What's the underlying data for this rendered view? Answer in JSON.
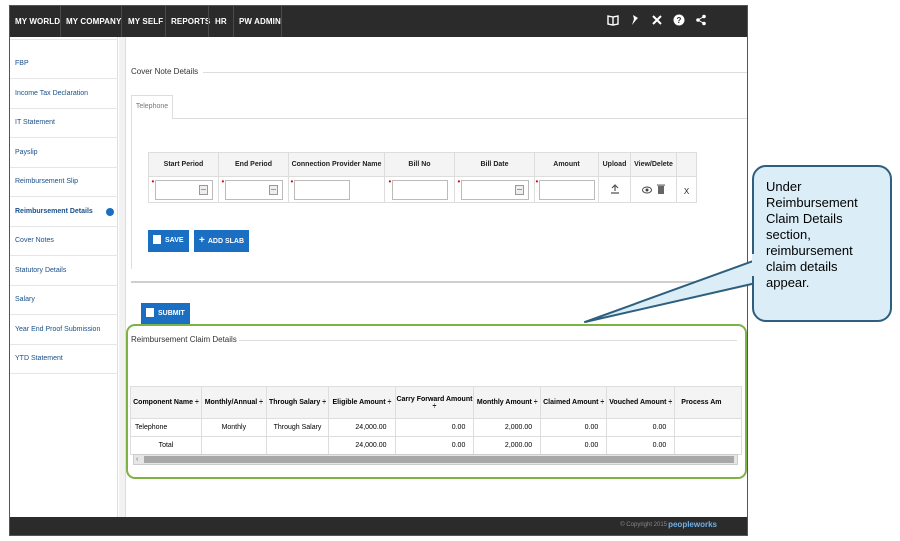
{
  "topnav": {
    "items": [
      "MY WORLD",
      "MY COMPANY",
      "MY SELF",
      "REPORTS",
      "HR",
      "PW ADMIN"
    ],
    "icons": [
      "book-icon",
      "pin-icon",
      "tools-icon",
      "help-icon",
      "share-icon"
    ]
  },
  "sidebar": {
    "items": [
      {
        "label": "FBP"
      },
      {
        "label": "Income Tax Declaration"
      },
      {
        "label": "IT Statement"
      },
      {
        "label": "Payslip"
      },
      {
        "label": "Reimbursement Slip"
      },
      {
        "label": "Reimbursement Details",
        "active": true
      },
      {
        "label": "Cover Notes"
      },
      {
        "label": "Statutory Details"
      },
      {
        "label": "Salary"
      },
      {
        "label": "Year End Proof Submission"
      },
      {
        "label": "YTD Statement"
      }
    ]
  },
  "cover_note": {
    "title": "Cover Note Details",
    "tab": "Telephone",
    "columns": [
      "Start Period",
      "End Period",
      "Connection Provider Name",
      "Bill No",
      "Bill Date",
      "Amount",
      "Upload",
      "View/Delete"
    ],
    "remove_label": "X",
    "save_label": "SAVE",
    "add_slab_label": "ADD SLAB",
    "submit_label": "SUBMIT"
  },
  "claim": {
    "title": "Reimbursement Claim Details",
    "columns": [
      "Component Name ÷",
      "Monthly/Annual ÷",
      "Through Salary ÷",
      "Eligible Amount ÷",
      "Carry Forward Amount ÷",
      "Monthly Amount ÷",
      "Claimed Amount ÷",
      "Vouched Amount ÷",
      "Process Am"
    ],
    "rows": [
      [
        "Telephone",
        "Monthly",
        "Through Salary",
        "24,000.00",
        "0.00",
        "2,000.00",
        "0.00",
        "0.00",
        ""
      ],
      [
        "Total",
        "",
        "",
        "24,000.00",
        "0.00",
        "2,000.00",
        "0.00",
        "0.00",
        ""
      ]
    ]
  },
  "footer": {
    "copyright": "© Copyright 2015",
    "brand": "peopleworks"
  },
  "callout": {
    "text": "Under Reimbursement Claim Details section, reimbursement claim details appear."
  },
  "colors": {
    "topbar": "#2b2b2b",
    "accent": "#1a6fc2",
    "highlight_border": "#7cb342",
    "callout_bg": "#dbeef7",
    "callout_border": "#2f5f7f"
  }
}
